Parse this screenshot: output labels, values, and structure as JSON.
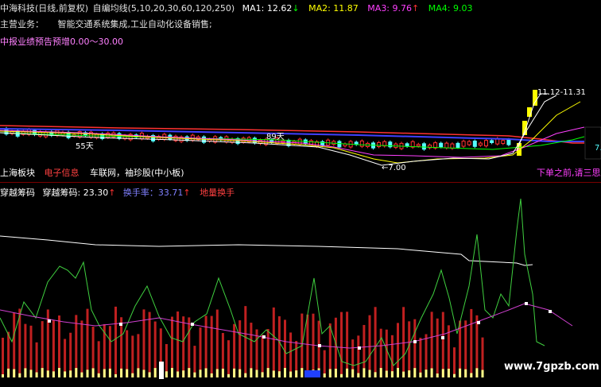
{
  "header": {
    "title": "中海科技(日线,前复权)",
    "indicator": "自编均线(5,10,20,30,60,120,250)",
    "ma": [
      {
        "label": "MA1: 12.62",
        "arrow": "↓",
        "color": "#ffffff"
      },
      {
        "label": "MA2: 11.87",
        "arrow": "",
        "color": "#ffff00"
      },
      {
        "label": "MA3: 9.76",
        "arrow": "↑",
        "color": "#ff40ff"
      },
      {
        "label": "MA4: 9.03",
        "arrow": "",
        "color": "#00ff00"
      }
    ]
  },
  "info": {
    "business_label": "主营业务：",
    "business_text": "智能交通系统集成,工业自动化设备销售;",
    "forecast": "中报业绩预告预增0.00～30.00"
  },
  "price_annotations": {
    "high": "11.12-11.31",
    "low": "7.00",
    "d55": "55天",
    "d89": "89天",
    "right_label": "7."
  },
  "sector": {
    "label": "上海板块",
    "tag": "电子信息",
    "concepts": "车联网，袖珍股(中小板)",
    "note": "下单之前,请三思!"
  },
  "indicator_bar": {
    "name": "穿越筹码",
    "value": "穿越筹码: 23.30",
    "value_arrow": "↑",
    "turnover": "换手率：33.71",
    "turnover_arrow": "↑",
    "tag": "地量换手"
  },
  "watermark": "www.7gpzb.com",
  "colors": {
    "up": "#ff3232",
    "down": "#54fcfc",
    "ma1": "#ffffff",
    "ma2": "#ffff00",
    "ma3": "#ff40ff",
    "ma4": "#00ff00",
    "label_orange": "#ffaa00",
    "label_red": "#ff4040",
    "label_magenta": "#ff40ff",
    "label_blue": "#8080ff"
  }
}
